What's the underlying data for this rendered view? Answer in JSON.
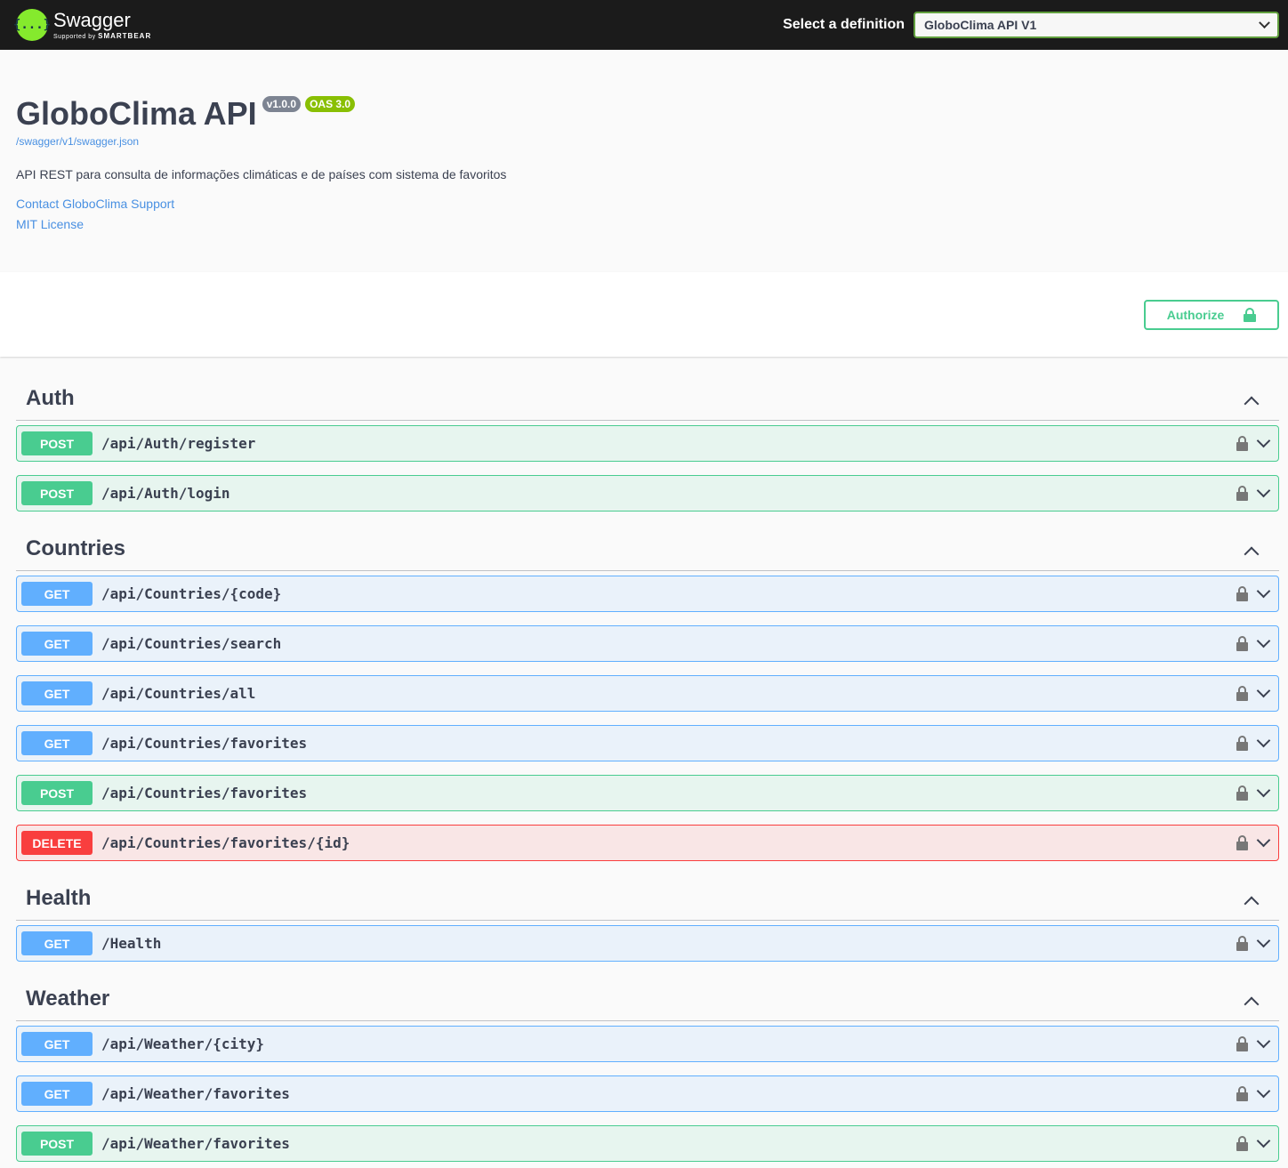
{
  "topbar": {
    "logo_icon": "{...}",
    "logo_name": "Swagger",
    "logo_sub_prefix": "Supported by",
    "logo_sub_brand": "SMARTBEAR",
    "definition_label": "Select a definition",
    "definition_value": "GloboClima API V1"
  },
  "info": {
    "title": "GloboClima API",
    "version": "v1.0.0",
    "oas": "OAS 3.0",
    "spec_url": "/swagger/v1/swagger.json",
    "description": "API REST para consulta de informações climáticas e de países com sistema de favoritos",
    "contact": "Contact GloboClima Support",
    "license": "MIT License"
  },
  "authorize_label": "Authorize",
  "colors": {
    "post": "#49cc90",
    "get": "#61afe",
    "delete": "#f93e3e",
    "accent": "#85ea2d"
  },
  "tags": [
    {
      "name": "Auth",
      "ops": [
        {
          "method": "POST",
          "path": "/api/Auth/register"
        },
        {
          "method": "POST",
          "path": "/api/Auth/login"
        }
      ]
    },
    {
      "name": "Countries",
      "ops": [
        {
          "method": "GET",
          "path": "/api/Countries/{code}"
        },
        {
          "method": "GET",
          "path": "/api/Countries/search"
        },
        {
          "method": "GET",
          "path": "/api/Countries/all"
        },
        {
          "method": "GET",
          "path": "/api/Countries/favorites"
        },
        {
          "method": "POST",
          "path": "/api/Countries/favorites"
        },
        {
          "method": "DELETE",
          "path": "/api/Countries/favorites/{id}"
        }
      ]
    },
    {
      "name": "Health",
      "ops": [
        {
          "method": "GET",
          "path": "/Health"
        }
      ]
    },
    {
      "name": "Weather",
      "ops": [
        {
          "method": "GET",
          "path": "/api/Weather/{city}"
        },
        {
          "method": "GET",
          "path": "/api/Weather/favorites"
        },
        {
          "method": "POST",
          "path": "/api/Weather/favorites"
        }
      ]
    }
  ]
}
